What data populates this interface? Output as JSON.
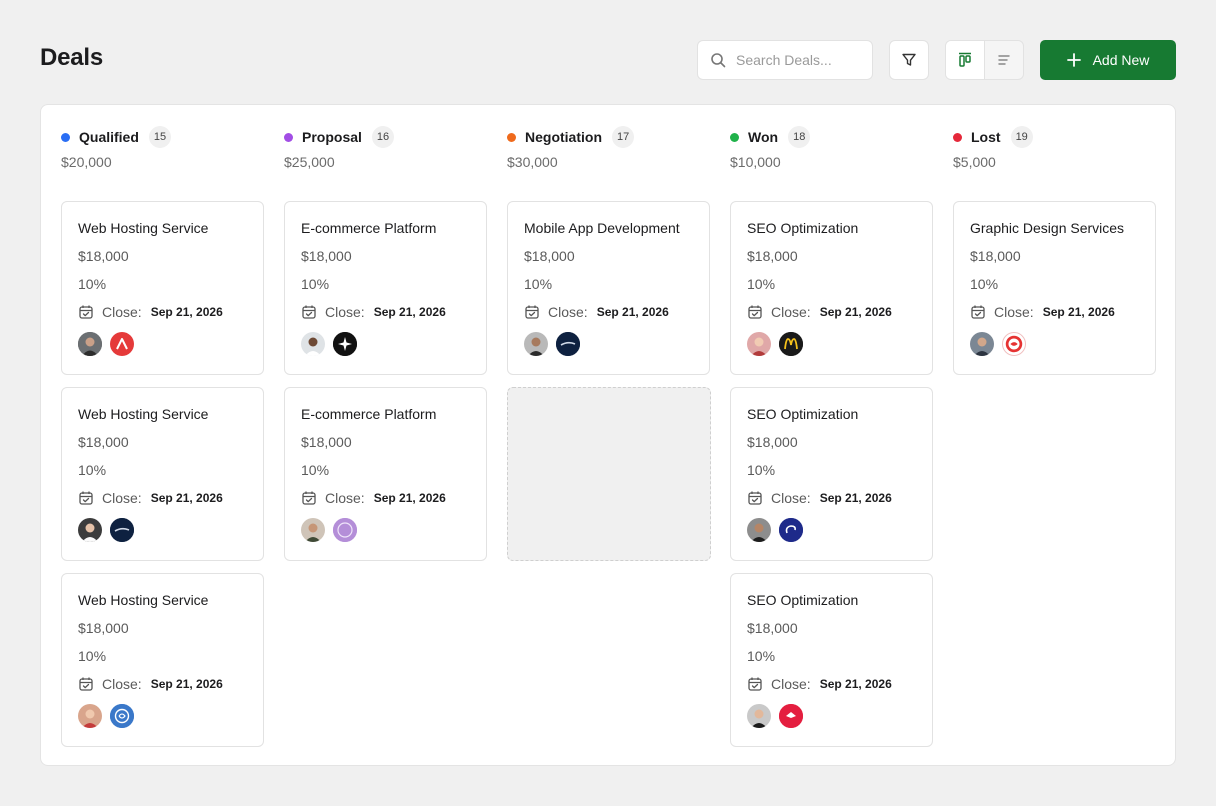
{
  "header": {
    "title": "Deals",
    "search_placeholder": "Search Deals...",
    "add_label": "Add New"
  },
  "colors": {
    "accent": "#177a32",
    "qualified": "#2a6ef4",
    "proposal": "#a24ee5",
    "negotiation": "#ef6a1c",
    "won": "#20b24a",
    "lost": "#e5283a"
  },
  "columns": [
    {
      "name": "Qualified",
      "count": "15",
      "total": "$20,000",
      "cards": [
        {
          "title": "Web Hosting Service",
          "amount": "$18,000",
          "probability": "10%",
          "close_label": "Close:",
          "close_date": "Sep 21, 2026"
        },
        {
          "title": "Web Hosting Service",
          "amount": "$18,000",
          "probability": "10%",
          "close_label": "Close:",
          "close_date": "Sep 21, 2026"
        },
        {
          "title": "Web Hosting Service",
          "amount": "$18,000",
          "probability": "10%",
          "close_label": "Close:",
          "close_date": "Sep 21, 2026"
        }
      ]
    },
    {
      "name": "Proposal",
      "count": "16",
      "total": "$25,000",
      "cards": [
        {
          "title": "E-commerce Platform",
          "amount": "$18,000",
          "probability": "10%",
          "close_label": "Close:",
          "close_date": "Sep 21, 2026"
        },
        {
          "title": "E-commerce Platform",
          "amount": "$18,000",
          "probability": "10%",
          "close_label": "Close:",
          "close_date": "Sep 21, 2026"
        }
      ]
    },
    {
      "name": "Negotiation",
      "count": "17",
      "total": "$30,000",
      "cards": [
        {
          "title": "Mobile App Development",
          "amount": "$18,000",
          "probability": "10%",
          "close_label": "Close:",
          "close_date": "Sep 21, 2026"
        }
      ]
    },
    {
      "name": "Won",
      "count": "18",
      "total": "$10,000",
      "cards": [
        {
          "title": "SEO Optimization",
          "amount": "$18,000",
          "probability": "10%",
          "close_label": "Close:",
          "close_date": "Sep 21, 2026"
        },
        {
          "title": "SEO Optimization",
          "amount": "$18,000",
          "probability": "10%",
          "close_label": "Close:",
          "close_date": "Sep 21, 2026"
        },
        {
          "title": "SEO Optimization",
          "amount": "$18,000",
          "probability": "10%",
          "close_label": "Close:",
          "close_date": "Sep 21, 2026"
        }
      ]
    },
    {
      "name": "Lost",
      "count": "19",
      "total": "$5,000",
      "cards": [
        {
          "title": "Graphic Design Services",
          "amount": "$18,000",
          "probability": "10%",
          "close_label": "Close:",
          "close_date": "Sep 21, 2026"
        }
      ]
    }
  ]
}
